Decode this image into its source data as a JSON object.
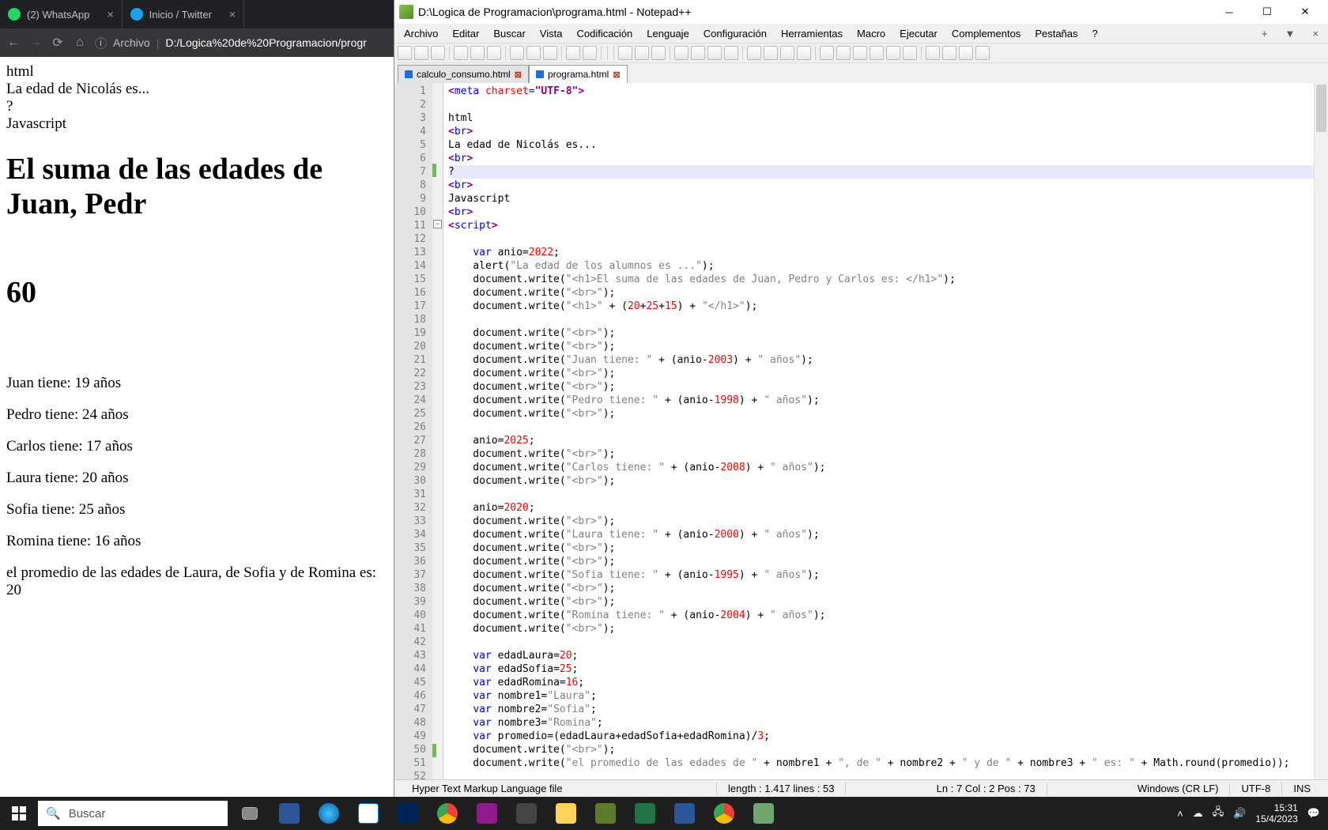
{
  "browser": {
    "tabs": [
      {
        "label": "(2) WhatsApp",
        "icon_color": "#25d366"
      },
      {
        "label": "Inicio / Twitter",
        "icon_color": "#1da1f2"
      }
    ],
    "url_prefix": "Archivo",
    "url_host": "D:/Logica%20de%20Programacion/progr",
    "page": {
      "l1": "html",
      "l2": "La edad de Nicolás es...",
      "l3": "?",
      "l4": "Javascript",
      "h1": "El suma de las edades de Juan, Pedr",
      "h2": "60",
      "p1": "Juan tiene: 19 años",
      "p2": "Pedro tiene: 24 años",
      "p3": "Carlos tiene: 17 años",
      "p4": "Laura tiene: 20 años",
      "p5": "Sofia tiene: 25 años",
      "p6": "Romina tiene: 16 años",
      "p7": "el promedio de las edades de Laura, de Sofia y de Romina es: 20"
    }
  },
  "npp": {
    "title": "D:\\Logica de Programacion\\programa.html - Notepad++",
    "menu": [
      "Archivo",
      "Editar",
      "Buscar",
      "Vista",
      "Codificación",
      "Lenguaje",
      "Configuración",
      "Herramientas",
      "Macro",
      "Ejecutar",
      "Complementos",
      "Pestañas",
      "?"
    ],
    "file_tabs": [
      "calculo_consumo.html",
      "programa.html"
    ],
    "status": {
      "type": "Hyper Text Markup Language file",
      "length": "length : 1.417    lines : 53",
      "pos": "Ln : 7    Col : 2    Pos : 73",
      "eol": "Windows (CR LF)",
      "enc": "UTF-8",
      "ins": "INS"
    },
    "code_lines": [
      {
        "n": 1,
        "html": "<span class='punc'>&lt;</span><span class='tag'>meta</span> <span class='attr'>charset</span><span class='tag'>=</span><span class='punc'>\"UTF-8\"&gt;</span>"
      },
      {
        "n": 2,
        "html": ""
      },
      {
        "n": 3,
        "html": "html"
      },
      {
        "n": 4,
        "html": "<span class='punc'>&lt;</span><span class='tag'>br</span><span class='punc'>&gt;</span>"
      },
      {
        "n": 5,
        "html": "La edad de Nicolás es..."
      },
      {
        "n": 6,
        "html": "<span class='punc'>&lt;</span><span class='tag'>br</span><span class='punc'>&gt;</span>"
      },
      {
        "n": 7,
        "html": "?",
        "hl": true
      },
      {
        "n": 8,
        "html": "<span class='punc'>&lt;</span><span class='tag'>br</span><span class='punc'>&gt;</span>"
      },
      {
        "n": 9,
        "html": "Javascript"
      },
      {
        "n": 10,
        "html": "<span class='punc'>&lt;</span><span class='tag'>br</span><span class='punc'>&gt;</span>"
      },
      {
        "n": 11,
        "html": "<span class='punc'>&lt;</span><span class='tag'>script</span><span class='punc'>&gt;</span>"
      },
      {
        "n": 12,
        "html": ""
      },
      {
        "n": 13,
        "html": "    <span class='kw'>var</span> anio=<span class='num'>2022</span>;"
      },
      {
        "n": 14,
        "html": "    alert(<span class='str'>\"La edad de los alumnos es ...\"</span>);"
      },
      {
        "n": 15,
        "html": "    document.write(<span class='str'>\"&lt;h1&gt;El suma de las edades de Juan, Pedro y Carlos es: &lt;/h1&gt;\"</span>);"
      },
      {
        "n": 16,
        "html": "    document.write(<span class='str'>\"&lt;br&gt;\"</span>);"
      },
      {
        "n": 17,
        "html": "    document.write(<span class='str'>\"&lt;h1&gt;\"</span> + (<span class='num'>20</span>+<span class='num'>25</span>+<span class='num'>15</span>) + <span class='str'>\"&lt;/h1&gt;\"</span>);"
      },
      {
        "n": 18,
        "html": ""
      },
      {
        "n": 19,
        "html": "    document.write(<span class='str'>\"&lt;br&gt;\"</span>);"
      },
      {
        "n": 20,
        "html": "    document.write(<span class='str'>\"&lt;br&gt;\"</span>);"
      },
      {
        "n": 21,
        "html": "    document.write(<span class='str'>\"Juan tiene: \"</span> + (anio-<span class='num'>2003</span>) + <span class='str'>\" años\"</span>);"
      },
      {
        "n": 22,
        "html": "    document.write(<span class='str'>\"&lt;br&gt;\"</span>);"
      },
      {
        "n": 23,
        "html": "    document.write(<span class='str'>\"&lt;br&gt;\"</span>);"
      },
      {
        "n": 24,
        "html": "    document.write(<span class='str'>\"Pedro tiene: \"</span> + (anio-<span class='num'>1998</span>) + <span class='str'>\" años\"</span>);"
      },
      {
        "n": 25,
        "html": "    document.write(<span class='str'>\"&lt;br&gt;\"</span>);"
      },
      {
        "n": 26,
        "html": ""
      },
      {
        "n": 27,
        "html": "    anio=<span class='num'>2025</span>;"
      },
      {
        "n": 28,
        "html": "    document.write(<span class='str'>\"&lt;br&gt;\"</span>);"
      },
      {
        "n": 29,
        "html": "    document.write(<span class='str'>\"Carlos tiene: \"</span> + (anio-<span class='num'>2008</span>) + <span class='str'>\" años\"</span>);"
      },
      {
        "n": 30,
        "html": "    document.write(<span class='str'>\"&lt;br&gt;\"</span>);"
      },
      {
        "n": 31,
        "html": ""
      },
      {
        "n": 32,
        "html": "    anio=<span class='num'>2020</span>;"
      },
      {
        "n": 33,
        "html": "    document.write(<span class='str'>\"&lt;br&gt;\"</span>);"
      },
      {
        "n": 34,
        "html": "    document.write(<span class='str'>\"Laura tiene: \"</span> + (anio-<span class='num'>2000</span>) + <span class='str'>\" años\"</span>);"
      },
      {
        "n": 35,
        "html": "    document.write(<span class='str'>\"&lt;br&gt;\"</span>);"
      },
      {
        "n": 36,
        "html": "    document.write(<span class='str'>\"&lt;br&gt;\"</span>);"
      },
      {
        "n": 37,
        "html": "    document.write(<span class='str'>\"Sofia tiene: \"</span> + (anio-<span class='num'>1995</span>) + <span class='str'>\" años\"</span>);"
      },
      {
        "n": 38,
        "html": "    document.write(<span class='str'>\"&lt;br&gt;\"</span>);"
      },
      {
        "n": 39,
        "html": "    document.write(<span class='str'>\"&lt;br&gt;\"</span>);"
      },
      {
        "n": 40,
        "html": "    document.write(<span class='str'>\"Romina tiene: \"</span> + (anio-<span class='num'>2004</span>) + <span class='str'>\" años\"</span>);"
      },
      {
        "n": 41,
        "html": "    document.write(<span class='str'>\"&lt;br&gt;\"</span>);"
      },
      {
        "n": 42,
        "html": ""
      },
      {
        "n": 43,
        "html": "    <span class='kw'>var</span> edadLaura=<span class='num'>20</span>;"
      },
      {
        "n": 44,
        "html": "    <span class='kw'>var</span> edadSofia=<span class='num'>25</span>;"
      },
      {
        "n": 45,
        "html": "    <span class='kw'>var</span> edadRomina=<span class='num'>16</span>;"
      },
      {
        "n": 46,
        "html": "    <span class='kw'>var</span> nombre1=<span class='str'>\"Laura\"</span>;"
      },
      {
        "n": 47,
        "html": "    <span class='kw'>var</span> nombre2=<span class='str'>\"Sofia\"</span>;"
      },
      {
        "n": 48,
        "html": "    <span class='kw'>var</span> nombre3=<span class='str'>\"Romina\"</span>;"
      },
      {
        "n": 49,
        "html": "    <span class='kw'>var</span> promedio=(edadLaura+edadSofia+edadRomina)/<span class='num'>3</span>;"
      },
      {
        "n": 50,
        "html": "    document.write(<span class='str'>\"&lt;br&gt;\"</span>);"
      },
      {
        "n": 51,
        "html": "    document.write(<span class='str'>\"el promedio de las edades de \"</span> + nombre1 + <span class='str'>\", de \"</span> + nombre2 + <span class='str'>\" y de \"</span> + nombre3 + <span class='str'>\" es: \"</span> + Math.round(promedio));"
      },
      {
        "n": 52,
        "html": ""
      }
    ]
  },
  "taskbar": {
    "search_placeholder": "Buscar",
    "time": "15:31",
    "date": "15/4/2023"
  }
}
